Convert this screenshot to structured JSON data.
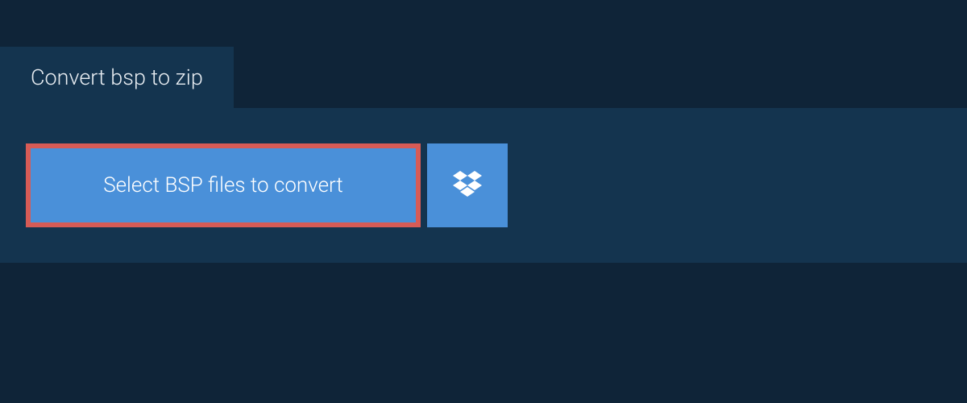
{
  "tab": {
    "label": "Convert bsp to zip"
  },
  "actions": {
    "select_files_label": "Select BSP files to convert"
  },
  "colors": {
    "background": "#0f2438",
    "panel": "#14344f",
    "button": "#4a90d9",
    "highlight_border": "#d75b56",
    "text": "#ffffff"
  }
}
